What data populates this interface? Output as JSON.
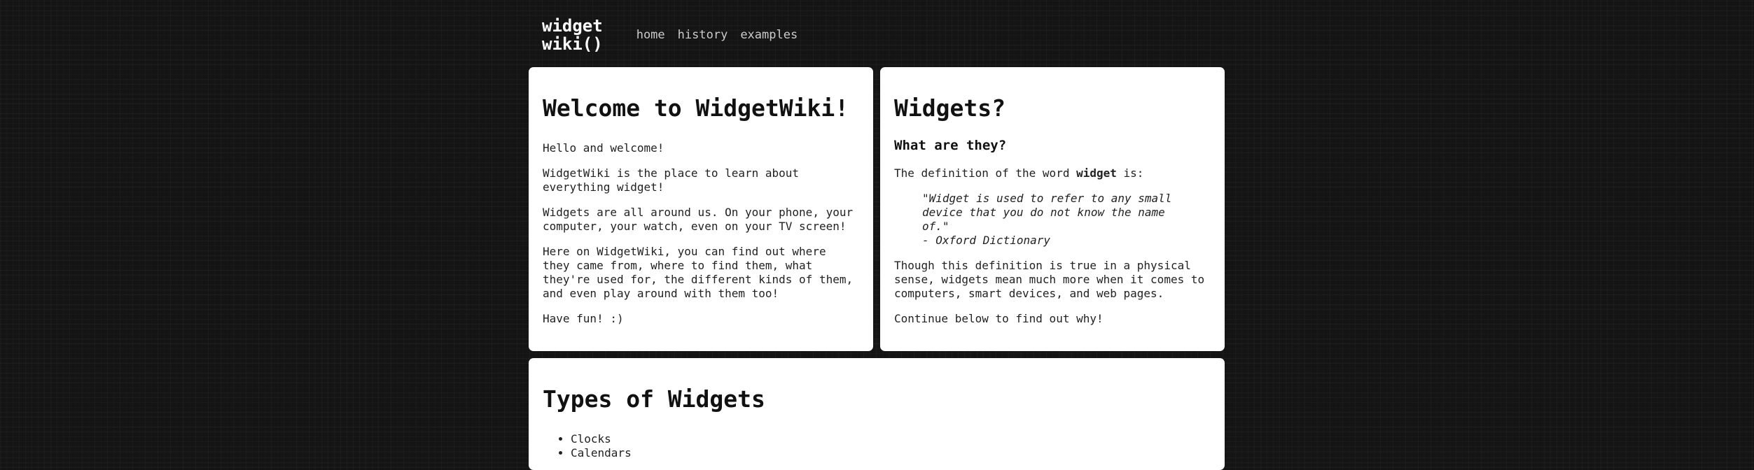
{
  "header": {
    "logo_line1": "widget",
    "logo_line2": "wiki()",
    "nav": [
      {
        "label": "home"
      },
      {
        "label": "history"
      },
      {
        "label": "examples"
      }
    ]
  },
  "welcome": {
    "title": "Welcome to WidgetWiki!",
    "paragraphs": [
      "Hello and welcome!",
      "WidgetWiki is the place to learn about everything widget!",
      "Widgets are all around us. On your phone, your computer, your watch, even on your TV screen!",
      "Here on WidgetWiki, you can find out where they came from, where to find them, what they're used for, the different kinds of them, and even play around with them too!",
      "Have fun! :)"
    ]
  },
  "widgets": {
    "title": "Widgets?",
    "subtitle": "What are they?",
    "definition_prefix": "The definition of the word ",
    "definition_word": "widget",
    "definition_suffix": " is:",
    "quote": "\"Widget is used to refer to any small device that you do not know the name of.\"",
    "quote_source": "- Oxford Dictionary",
    "paragraph1": "Though this definition is true in a physical sense, widgets mean much more when it comes to computers, smart devices, and web pages.",
    "paragraph2": "Continue below to find out why!"
  },
  "types": {
    "title": "Types of Widgets",
    "items": [
      "Clocks",
      "Calendars"
    ]
  }
}
